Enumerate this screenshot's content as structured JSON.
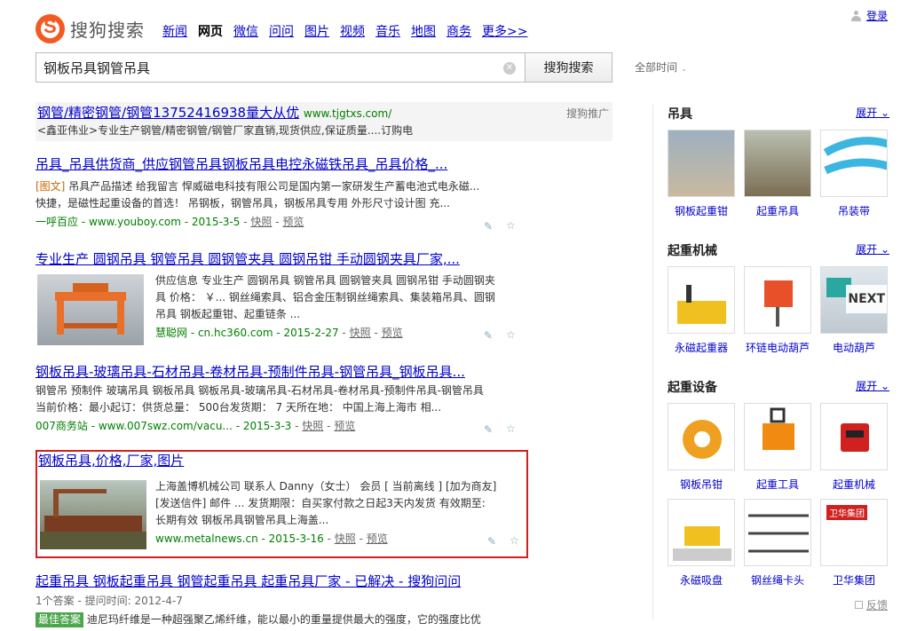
{
  "header": {
    "logo_text": "搜狗搜索",
    "nav": [
      "新闻",
      "网页",
      "微信",
      "问问",
      "图片",
      "视频",
      "音乐",
      "地图",
      "商务",
      "更多>>"
    ],
    "login": "登录"
  },
  "search": {
    "query": "钢板吊具钢管吊具",
    "button": "搜狗搜索",
    "time_filter": "全部时间"
  },
  "results": [
    {
      "title": "钢管/精密钢管/钢管13752416938量大从优",
      "url_inline": "www.tjgtxs.com/",
      "desc": "<鑫亚伟业>专业生产钢管/精密钢管/钢管厂家直销,现货供应,保证质量....订购电",
      "ad_mark": "搜狗推广"
    },
    {
      "title": "吊具_吊具供货商_供应钢管吊具钢板吊具电控永磁铁吊具_吊具价格_...",
      "tag": "[图文]",
      "desc1": "吊具产品描述 给我留言 悍威磁电科技有限公司是国内第一家研发生产蓄电池式电永磁...",
      "desc2": "快捷，是磁性起重设备的首选！ 吊钢板，钢管吊具，钢板吊具专用 外形尺寸设计图 充...",
      "site": "一呼百应 - www.youboy.com - 2015-3-5",
      "snapshot": "快照",
      "preview": "预览"
    },
    {
      "title": "专业生产 圆钢吊具 钢管吊具 圆钢管夹具 圆钢吊钳 手动圆钢夹具厂家,...",
      "desc1": "供应信息 专业生产 圆钢吊具 钢管吊具 圆钢管夹具 圆钢吊钳 手动圆钢夹",
      "desc2": "具 价格： ￥... 钢丝绳索具、铝合金压制钢丝绳索具、集装箱吊具、圆钢",
      "desc3": "吊具 钢板起重钳、起重链条 ...",
      "site": "慧聪网 - cn.hc360.com - 2015-2-27",
      "snapshot": "快照",
      "preview": "预览"
    },
    {
      "title": "钢板吊具-玻璃吊具-石材吊具-卷材吊具-预制件吊具-钢管吊具_钢板吊具...",
      "desc1": "钢管吊 预制件 玻璃吊具 钢板吊具 钢板吊具-玻璃吊具-石材吊具-卷材吊具-预制件吊具-钢管吊具",
      "desc2": "当前价格：最小起订：供货总量： 500台发货期： 7 天所在地： 中国上海上海市 相...",
      "site": "007商务站 - www.007swz.com/vacu... - 2015-3-3",
      "snapshot": "快照",
      "preview": "预览"
    },
    {
      "title": "钢板吊具,价格,厂家,图片",
      "desc1": "上海盖博机械公司 联系人 Danny（女士） 会员 [ 当前离线 ] [加为商友]",
      "desc2": "[发送信件] 邮件 ... 发货期限：自买家付款之日起3天内发货 有效期至:",
      "desc3": "长期有效 钢板吊具钢管吊具上海盖...",
      "site": "www.metalnews.cn - 2015-3-16",
      "snapshot": "快照",
      "preview": "预览"
    },
    {
      "title": "起重吊具 钢板起重吊具 钢管起重吊具 起重吊具厂家 - 已解决 - 搜狗问问",
      "meta": "1个答案 - 提问时间: 2012-4-7",
      "badge": "最佳答案",
      "desc": "迪尼玛纤维是一种超强聚乙烯纤维，能以最小的重量提供最大的强度，它的强度比优"
    }
  ],
  "sidebar": [
    {
      "heading": "吊具",
      "more": "展开",
      "items": [
        "钢板起重钳",
        "起重吊具",
        "吊装带"
      ]
    },
    {
      "heading": "起重机械",
      "more": "展开",
      "items": [
        "永磁起重器",
        "环链电动葫芦",
        "电动葫芦"
      ],
      "next": "NEXT"
    },
    {
      "heading": "起重设备",
      "more": "展开",
      "items": [
        "钢板吊钳",
        "起重工具",
        "起重机械",
        "永磁吸盘",
        "钢丝绳卡头",
        "卫华集团"
      ]
    }
  ],
  "brand_logo_text": "卫华集团",
  "feedback": "反馈",
  "colors": {
    "accent": "#f25a22",
    "link": "#0000cc",
    "highlight": "#cc0000",
    "green": "#008000",
    "border_red": "#d02020"
  }
}
